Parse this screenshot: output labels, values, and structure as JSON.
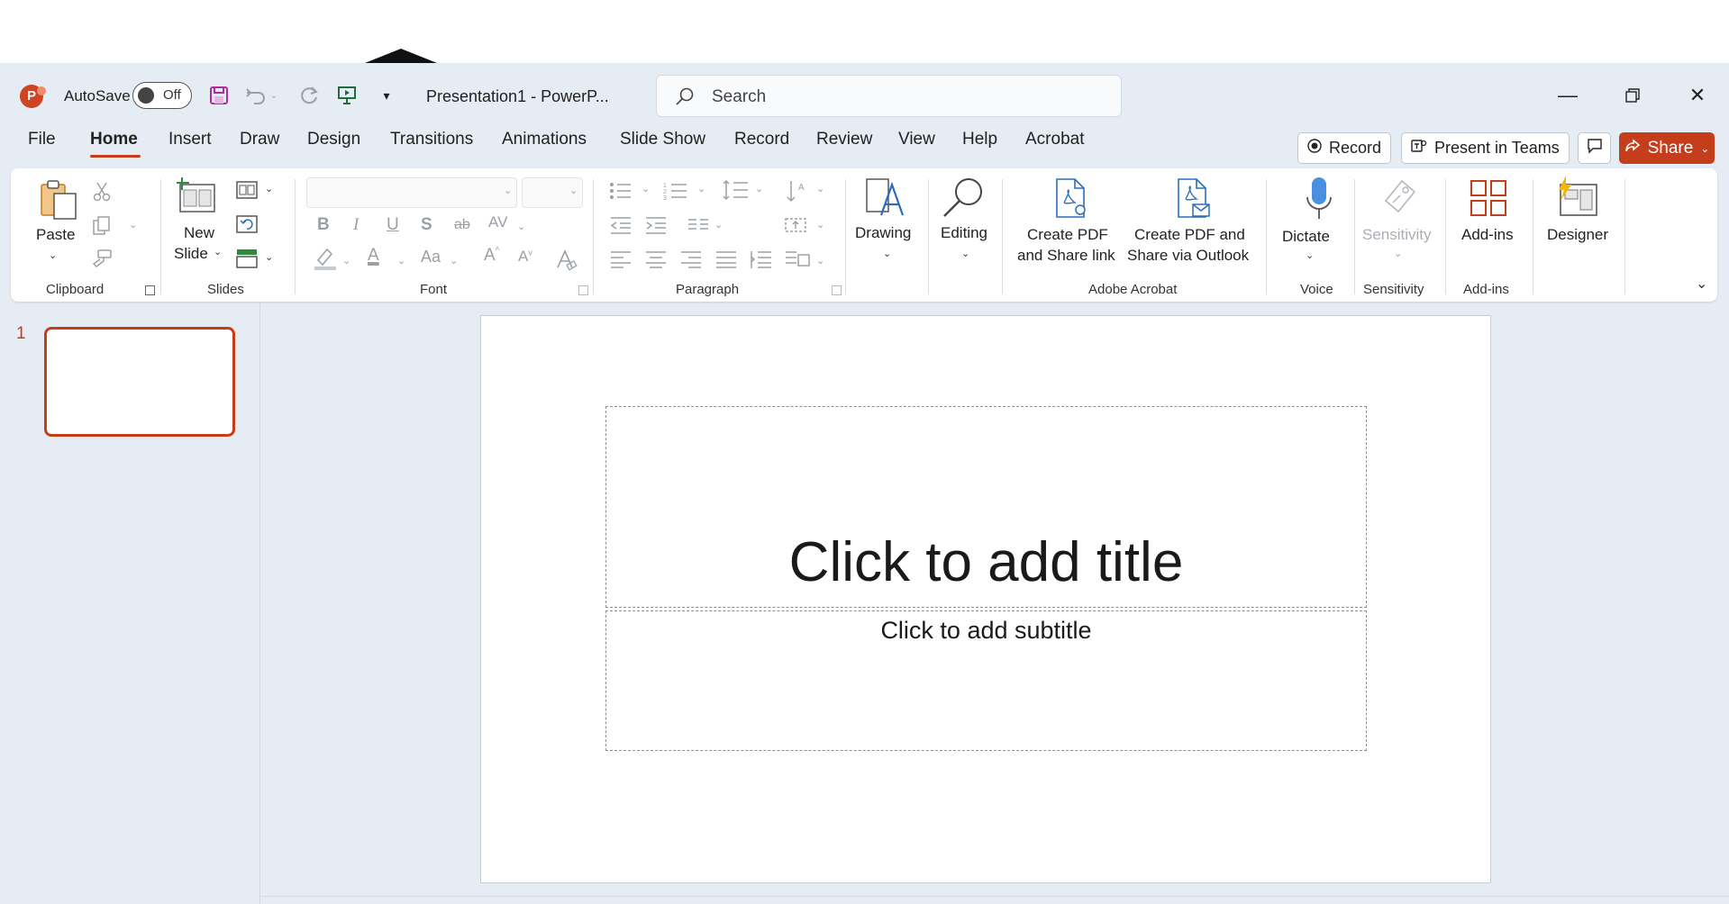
{
  "window": {
    "title": "Presentation1  -  PowerP...",
    "autosave_label": "AutoSave",
    "autosave_state": "Off",
    "search_placeholder": "Search",
    "logo_letter": "P"
  },
  "menu": {
    "tabs": [
      "File",
      "Home",
      "Insert",
      "Draw",
      "Design",
      "Transitions",
      "Animations",
      "Slide Show",
      "Record",
      "Review",
      "View",
      "Help",
      "Acrobat"
    ],
    "active_tab": "Home",
    "record_button": "Record",
    "present_button": "Present in Teams",
    "share_button": "Share"
  },
  "ribbon": {
    "clipboard": {
      "paste": "Paste",
      "label": "Clipboard"
    },
    "slides": {
      "new_slide_1": "New",
      "new_slide_2": "Slide",
      "label": "Slides"
    },
    "font": {
      "label": "Font"
    },
    "paragraph": {
      "label": "Paragraph"
    },
    "drawing": {
      "label": "Drawing"
    },
    "editing": {
      "label": "Editing"
    },
    "acrobat": {
      "create_pdf_link_1": "Create PDF",
      "create_pdf_link_2": "and Share link",
      "create_pdf_outlook_1": "Create PDF and",
      "create_pdf_outlook_2": "Share via Outlook",
      "label": "Adobe Acrobat"
    },
    "voice": {
      "dictate": "Dictate",
      "label": "Voice"
    },
    "sensitivity": {
      "button": "Sensitivity",
      "label": "Sensitivity"
    },
    "addins": {
      "button": "Add-ins",
      "label": "Add-ins"
    },
    "designer": {
      "button": "Designer"
    }
  },
  "slides_pane": {
    "thumb_number": "1"
  },
  "slide": {
    "title_placeholder": "Click to add title",
    "subtitle_placeholder": "Click to add subtitle"
  },
  "colors": {
    "accent": "#c43e1c",
    "app_bg": "#e6ecf3"
  }
}
